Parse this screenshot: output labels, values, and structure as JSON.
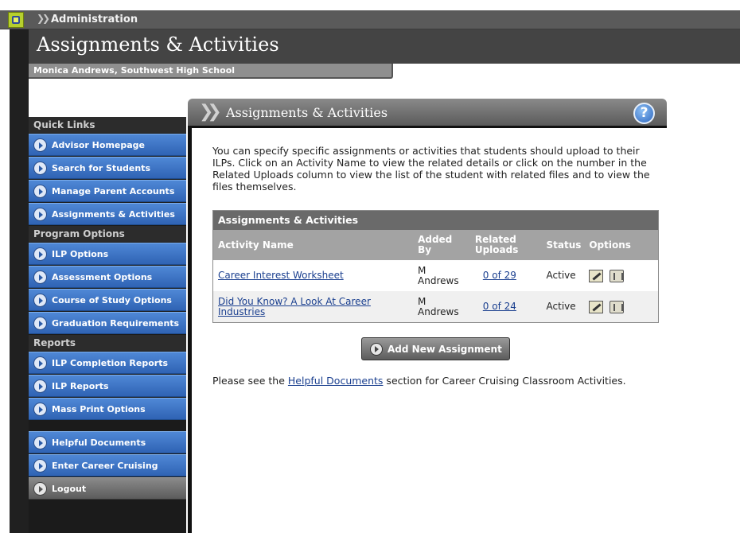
{
  "admin_bar": {
    "title": "Administration"
  },
  "page": {
    "title": "Assignments & Activities",
    "user_line": "Monica Andrews, Southwest High School"
  },
  "sidebar": {
    "sections": [
      {
        "heading": "Quick Links",
        "items": [
          "Advisor Homepage",
          "Search for Students",
          "Manage Parent Accounts",
          "Assignments & Activities"
        ]
      },
      {
        "heading": "Program Options",
        "items": [
          "ILP Options",
          "Assessment Options",
          "Course of Study Options",
          "Graduation Requirements"
        ]
      },
      {
        "heading": "Reports",
        "items": [
          "ILP Completion Reports",
          "ILP Reports",
          "Mass Print Options"
        ]
      }
    ],
    "extra_items": [
      "Helpful Documents",
      "Enter Career Cruising"
    ],
    "logout": "Logout"
  },
  "panel": {
    "title": "Assignments & Activities",
    "help_glyph": "?",
    "intro": "You can specify specific assignments or activities that students should upload to their ILPs. Click on an Activity Name to view the related details or click on the number in the Related Uploads column to view the list of the student with related files and to view the files themselves."
  },
  "table": {
    "caption": "Assignments & Activities",
    "headers": {
      "name": "Activity Name",
      "added_by": "Added By",
      "uploads": "Related Uploads",
      "status": "Status",
      "options": "Options"
    },
    "rows": [
      {
        "name": "Career Interest Worksheet",
        "added_by": "M Andrews",
        "uploads": "0 of 29",
        "status": "Active"
      },
      {
        "name": "Did You Know? A Look At Career Industries",
        "added_by": "M Andrews",
        "uploads": "0 of 24",
        "status": "Active"
      }
    ]
  },
  "add_button": "Add New Assignment",
  "footnote": {
    "before": "Please see the ",
    "link": "Helpful Documents",
    "after": " section for Career Cruising Classroom Activities."
  }
}
